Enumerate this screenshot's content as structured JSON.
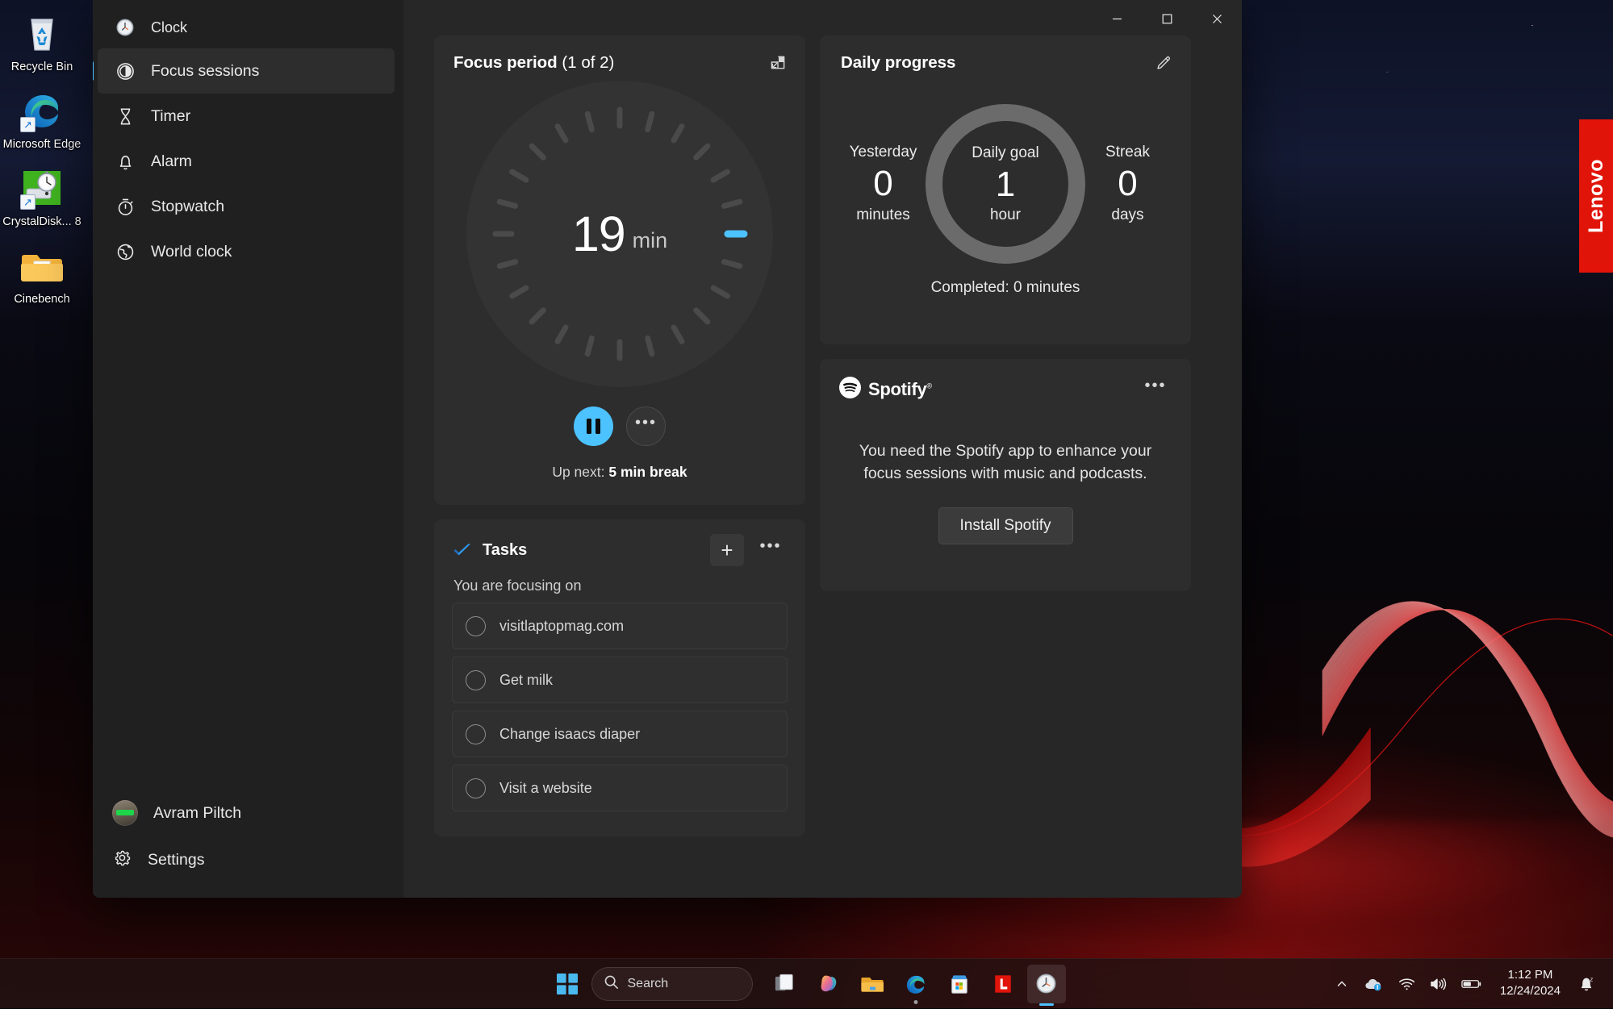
{
  "desktop": {
    "icons": [
      {
        "label": "Recycle Bin",
        "icon": "recycle-bin-icon"
      },
      {
        "label": "Microsoft Edge",
        "icon": "edge-icon"
      },
      {
        "label": "CrystalDisk... 8",
        "icon": "crystaldiskmark-icon"
      },
      {
        "label": "Cinebench",
        "icon": "folder-icon"
      }
    ],
    "lenovo_tab": "Lenovo"
  },
  "window": {
    "title": "Clock",
    "controls": {
      "minimize": "–",
      "maximize": "☐",
      "close": "✕"
    }
  },
  "sidebar": {
    "app_title": "Clock",
    "items": [
      {
        "label": "Focus sessions",
        "icon": "focus-sessions-icon",
        "selected": true
      },
      {
        "label": "Timer",
        "icon": "hourglass-icon",
        "selected": false
      },
      {
        "label": "Alarm",
        "icon": "bell-icon",
        "selected": false
      },
      {
        "label": "Stopwatch",
        "icon": "stopwatch-icon",
        "selected": false
      },
      {
        "label": "World clock",
        "icon": "globe-icon",
        "selected": false
      }
    ],
    "profile_name": "Avram Piltch",
    "settings_label": "Settings"
  },
  "focus_period": {
    "title": "Focus period",
    "subtitle": "(1 of 2)",
    "minutes": "19",
    "unit": "min",
    "mini_view_icon": "compact-overlay-icon",
    "pause_label": "Pause",
    "more_label": "•••",
    "up_next_prefix": "Up next: ",
    "up_next_value": "5 min break",
    "dial": {
      "total_ticks": 24,
      "active_tick_index": 6,
      "active_color": "#4cc2ff",
      "tick_color": "#4a4a4a",
      "face_color": "#333333"
    }
  },
  "tasks": {
    "title": "Tasks",
    "logo_icon": "microsoft-todo-icon",
    "add_label": "+",
    "more_label": "•••",
    "focusing_label": "You are focusing on",
    "items": [
      {
        "label": "visitlaptopmag.com",
        "done": false
      },
      {
        "label": "Get milk",
        "done": false
      },
      {
        "label": "Change isaacs diaper",
        "done": false
      },
      {
        "label": "Visit a website",
        "done": false
      }
    ]
  },
  "daily_progress": {
    "title": "Daily progress",
    "edit_icon": "pencil-icon",
    "yesterday": {
      "top": "Yesterday",
      "value": "0",
      "bottom": "minutes"
    },
    "goal": {
      "top": "Daily goal",
      "value": "1",
      "bottom": "hour"
    },
    "streak": {
      "top": "Streak",
      "value": "0",
      "bottom": "days"
    },
    "completed": "Completed: 0 minutes",
    "ring_color": "#6b6b6b",
    "ring_progress_pct": 0
  },
  "spotify": {
    "brand": "Spotify",
    "brand_mark": "®",
    "logo_icon": "spotify-icon",
    "more_label": "•••",
    "message": "You need the Spotify app to enhance your focus sessions with music and podcasts.",
    "install_label": "Install Spotify"
  },
  "taskbar": {
    "start_icon": "windows-start-icon",
    "search_placeholder": "Search",
    "search_icon": "search-icon",
    "apps": [
      {
        "name": "task-view-icon",
        "active": false,
        "running": false
      },
      {
        "name": "copilot-icon",
        "active": false,
        "running": false
      },
      {
        "name": "file-explorer-icon",
        "active": false,
        "running": false
      },
      {
        "name": "microsoft-edge-icon",
        "active": false,
        "running": true
      },
      {
        "name": "microsoft-store-icon",
        "active": false,
        "running": false
      },
      {
        "name": "lenovo-vantage-icon",
        "active": false,
        "running": false
      },
      {
        "name": "clock-icon",
        "active": true,
        "running": true
      }
    ],
    "tray": {
      "chevron": "⌃",
      "onedrive_icon": "onedrive-icon",
      "wifi_icon": "wifi-icon",
      "volume_icon": "volume-icon",
      "battery_icon": "battery-icon",
      "time": "1:12 PM",
      "date": "12/24/2024",
      "notification_icon": "notifications-silent-icon"
    }
  }
}
